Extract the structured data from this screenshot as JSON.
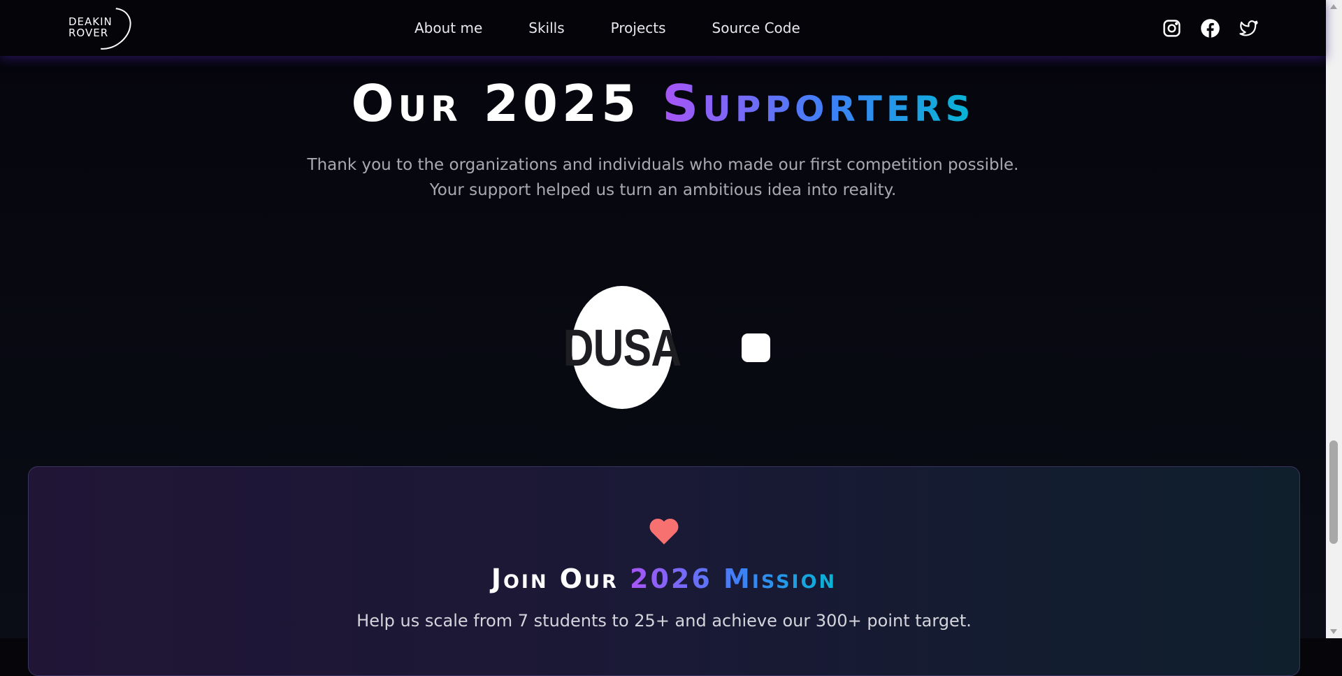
{
  "nav": {
    "logo_text": [
      "DEAKIN",
      "ROVER"
    ],
    "links": [
      "About me",
      "Skills",
      "Projects",
      "Source Code"
    ],
    "social_icons": [
      "instagram-icon",
      "facebook-icon",
      "twitter-icon"
    ]
  },
  "supporters": {
    "title_plain": "Our 2025 ",
    "title_accent": "Supporters",
    "subtitle_lines": [
      "Thank you to the organizations and individuals who made our first competition possible.",
      "Your support helped us turn an ambitious idea into reality."
    ],
    "logos": [
      {
        "text": "DUSA"
      }
    ]
  },
  "join": {
    "icon": "heart-icon",
    "title_plain": "Join Our ",
    "title_accent": "2026 Mission",
    "text": "Help us scale from 7 students to 25+ and achieve our 300+ point target."
  },
  "colors": {
    "accent_start": "#a855f7",
    "accent_mid": "#3b82f6",
    "accent_end": "#06b6d4",
    "heart": "#f87171"
  }
}
